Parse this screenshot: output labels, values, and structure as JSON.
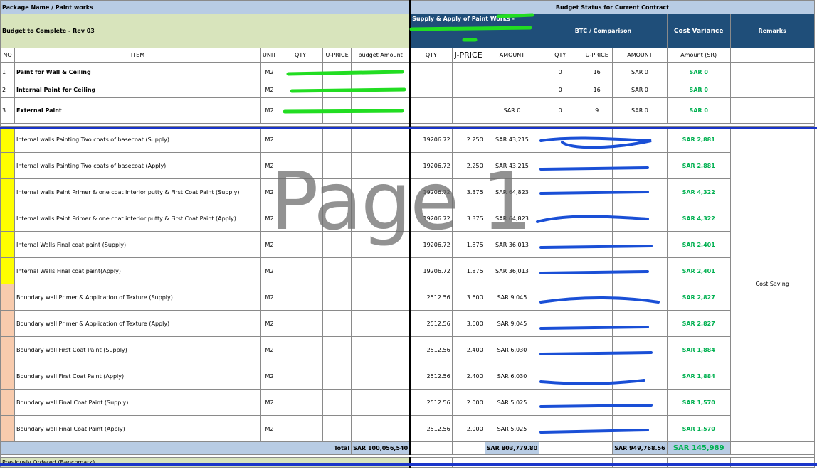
{
  "header": {
    "package_name": "Package Name / Paint works",
    "budget_status": "Budget Status for Current Contract",
    "budget_to_complete": "Budget to Complete - Rev 03",
    "supply_apply": "Supply & Apply of Paint Works -",
    "btc_comparison": "BTC / Comparison",
    "cost_variance": "Cost Variance",
    "remarks": "Remarks"
  },
  "columns": {
    "no": "NO",
    "item": "ITEM",
    "unit": "UNIT",
    "qty": "QTY",
    "uprice": "U-PRICE",
    "budget_amount": "budget Amount",
    "qty2": "QTY",
    "uprice2": "J-PRICE",
    "amount2": "AMOUNT",
    "qty3": "QTY",
    "uprice3": "U-PRICE",
    "amount3": "AMOUNT",
    "variance": "Amount (SR)"
  },
  "summary_rows": [
    {
      "no": "1",
      "item": "Paint for Wall & Ceiling",
      "unit": "M2",
      "amount2": "",
      "qty3": "0",
      "uprice3": "16",
      "amount3": "SAR 0",
      "variance": "SAR 0"
    },
    {
      "no": "2",
      "item": "Internal Paint for Ceiling",
      "unit": "M2",
      "amount2": "",
      "qty3": "0",
      "uprice3": "16",
      "amount3": "SAR 0",
      "variance": "SAR 0"
    },
    {
      "no": "3",
      "item": "External Paint",
      "unit": "M2",
      "amount2": "SAR 0",
      "qty3": "0",
      "uprice3": "9",
      "amount3": "SAR 0",
      "variance": "SAR 0"
    }
  ],
  "detail_rows": [
    {
      "item": "Internal walls Painting Two coats of basecoat (Supply)",
      "unit": "M2",
      "qty": "19206.72",
      "uprice": "2.250",
      "amount": "SAR 43,215",
      "variance": "SAR 2,881",
      "mark": "yellow"
    },
    {
      "item": "Internal walls Painting Two coats of basecoat (Apply)",
      "unit": "M2",
      "qty": "19206.72",
      "uprice": "2.250",
      "amount": "SAR 43,215",
      "variance": "SAR 2,881",
      "mark": "yellow"
    },
    {
      "item": "Internal walls Paint Primer & one coat interior putty & First Coat Paint (Supply)",
      "unit": "M2",
      "qty": "19206.72",
      "uprice": "3.375",
      "amount": "SAR 64,823",
      "variance": "SAR 4,322",
      "mark": "yellow"
    },
    {
      "item": "Internal walls Paint Primer & one coat interior putty & First Coat Paint (Apply)",
      "unit": "M2",
      "qty": "19206.72",
      "uprice": "3.375",
      "amount": "SAR 64,823",
      "variance": "SAR 4,322",
      "mark": "yellow"
    },
    {
      "item": "Internal Walls Final coat paint (Supply)",
      "unit": "M2",
      "qty": "19206.72",
      "uprice": "1.875",
      "amount": "SAR 36,013",
      "variance": "SAR 2,401",
      "mark": "yellow"
    },
    {
      "item": "Internal Walls Final coat paint(Apply)",
      "unit": "M2",
      "qty": "19206.72",
      "uprice": "1.875",
      "amount": "SAR 36,013",
      "variance": "SAR 2,401",
      "mark": "yellow"
    },
    {
      "item": "Boundary wall Primer & Application of Texture (Supply)",
      "unit": "M2",
      "qty": "2512.56",
      "uprice": "3.600",
      "amount": "SAR 9,045",
      "variance": "SAR 2,827",
      "mark": "salmon"
    },
    {
      "item": "Boundary wall Primer & Application of Texture (Apply)",
      "unit": "M2",
      "qty": "2512.56",
      "uprice": "3.600",
      "amount": "SAR 9,045",
      "variance": "SAR 2,827",
      "mark": "salmon"
    },
    {
      "item": "Boundary wall First Coat Paint (Supply)",
      "unit": "M2",
      "qty": "2512.56",
      "uprice": "2.400",
      "amount": "SAR 6,030",
      "variance": "SAR 1,884",
      "mark": "salmon"
    },
    {
      "item": "Boundary wall First Coat Paint (Apply)",
      "unit": "M2",
      "qty": "2512.56",
      "uprice": "2.400",
      "amount": "SAR 6,030",
      "variance": "SAR 1,884",
      "mark": "salmon"
    },
    {
      "item": "Boundary wall Final Coat Paint (Supply)",
      "unit": "M2",
      "qty": "2512.56",
      "uprice": "2.000",
      "amount": "SAR 5,025",
      "variance": "SAR 1,570",
      "mark": "salmon"
    },
    {
      "item": "Boundary wall Final Coat Paint (Apply)",
      "unit": "M2",
      "qty": "2512.56",
      "uprice": "2.000",
      "amount": "SAR 5,025",
      "variance": "SAR 1,570",
      "mark": "salmon"
    }
  ],
  "remarks_text": "Cost Saving",
  "totals": {
    "label": "Total",
    "budget_amount": "SAR 100,056,540",
    "amount2": "SAR 803,779.80",
    "amount3": "SAR 949,768.56",
    "variance": "SAR 145,989"
  },
  "footer": {
    "previously_ordered": "Previously Ordered (Benchmark)"
  },
  "watermark": "Page 1",
  "colors": {
    "header_blue": "#b8cce4",
    "header_green": "#d8e4bc",
    "header_navy": "#1f4e79",
    "variance_green": "#00b050",
    "marker_yellow": "#ffff00",
    "marker_salmon": "#f8cbad",
    "redaction_blue": "#1a4fd6",
    "redaction_green": "#22dd22"
  }
}
